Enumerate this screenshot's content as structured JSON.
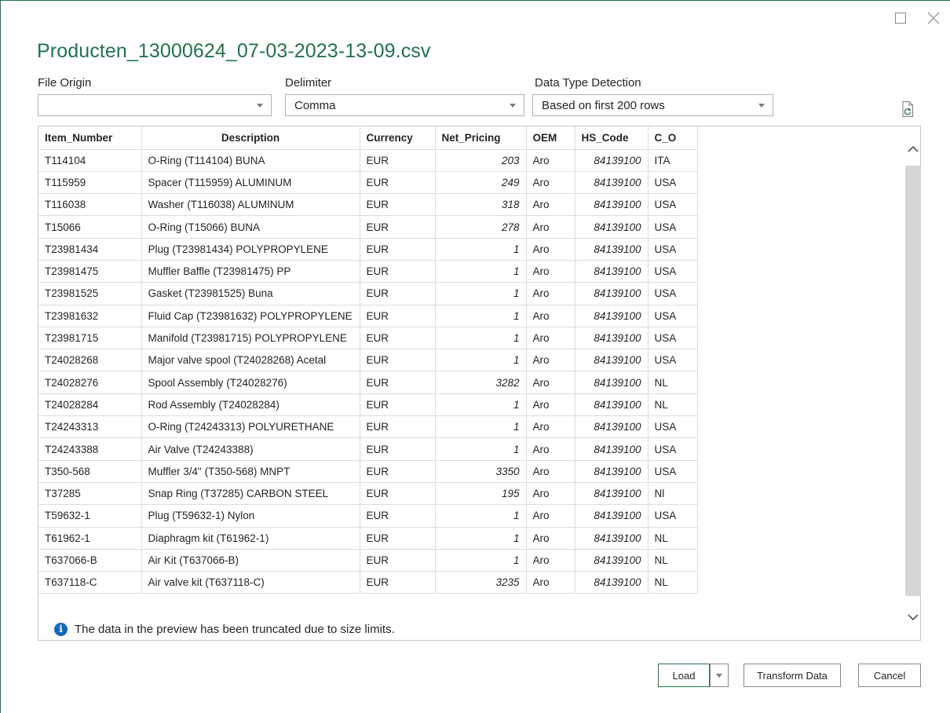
{
  "title": "Producten_13000624_07-03-2023-13-09.csv",
  "file_origin": {
    "label": "File Origin",
    "value": ""
  },
  "delimiter": {
    "label": "Delimiter",
    "value": "Comma"
  },
  "data_type_detection": {
    "label": "Data Type Detection",
    "value": "Based on first 200 rows"
  },
  "table": {
    "headers": [
      "Item_Number",
      "Description",
      "Currency",
      "Net_Pricing",
      "OEM",
      "HS_Code",
      "C_O"
    ],
    "rows": [
      [
        "T114104",
        "O-Ring (T114104) BUNA",
        "EUR",
        "203",
        "Aro",
        "84139100",
        "ITA"
      ],
      [
        "T115959",
        "Spacer (T115959) ALUMINUM",
        "EUR",
        "249",
        "Aro",
        "84139100",
        "USA"
      ],
      [
        "T116038",
        "Washer (T116038) ALUMINUM",
        "EUR",
        "318",
        "Aro",
        "84139100",
        "USA"
      ],
      [
        "T15066",
        "O-Ring (T15066) BUNA",
        "EUR",
        "278",
        "Aro",
        "84139100",
        "USA"
      ],
      [
        "T23981434",
        "Plug (T23981434) POLYPROPYLENE",
        "EUR",
        "1",
        "Aro",
        "84139100",
        "USA"
      ],
      [
        "T23981475",
        "Muffler Baffle (T23981475) PP",
        "EUR",
        "1",
        "Aro",
        "84139100",
        "USA"
      ],
      [
        "T23981525",
        "Gasket (T23981525) Buna",
        "EUR",
        "1",
        "Aro",
        "84139100",
        "USA"
      ],
      [
        "T23981632",
        "Fluid Cap (T23981632) POLYPROPYLENE",
        "EUR",
        "1",
        "Aro",
        "84139100",
        "USA"
      ],
      [
        "T23981715",
        "Manifold (T23981715) POLYPROPYLENE",
        "EUR",
        "1",
        "Aro",
        "84139100",
        "USA"
      ],
      [
        "T24028268",
        "Major valve spool (T24028268) Acetal",
        "EUR",
        "1",
        "Aro",
        "84139100",
        "USA"
      ],
      [
        "T24028276",
        "Spool Assembly (T24028276)",
        "EUR",
        "3282",
        "Aro",
        "84139100",
        "NL"
      ],
      [
        "T24028284",
        "Rod Assembly (T24028284)",
        "EUR",
        "1",
        "Aro",
        "84139100",
        "NL"
      ],
      [
        "T24243313",
        "O-Ring (T24243313) POLYURETHANE",
        "EUR",
        "1",
        "Aro",
        "84139100",
        "USA"
      ],
      [
        "T24243388",
        "Air Valve (T24243388)",
        "EUR",
        "1",
        "Aro",
        "84139100",
        "USA"
      ],
      [
        "T350-568",
        "Muffler 3/4\" (T350-568) MNPT",
        "EUR",
        "3350",
        "Aro",
        "84139100",
        "USA"
      ],
      [
        "T37285",
        "Snap Ring (T37285) CARBON STEEL",
        "EUR",
        "195",
        "Aro",
        "84139100",
        "Nl"
      ],
      [
        "T59632-1",
        "Plug (T59632-1) Nylon",
        "EUR",
        "1",
        "Aro",
        "84139100",
        "USA"
      ],
      [
        "T61962-1",
        "Diaphragm kit (T61962-1)",
        "EUR",
        "1",
        "Aro",
        "84139100",
        "NL"
      ],
      [
        "T637066-B",
        "Air Kit (T637066-B)",
        "EUR",
        "1",
        "Aro",
        "84139100",
        "NL"
      ],
      [
        "T637118-C",
        "Air valve kit (T637118-C)",
        "EUR",
        "3235",
        "Aro",
        "84139100",
        "NL"
      ]
    ]
  },
  "info_message": "The data in the preview has been truncated due to size limits.",
  "info_icon_glyph": "i",
  "buttons": {
    "load": "Load",
    "transform": "Transform Data",
    "cancel": "Cancel"
  },
  "colors": {
    "accent": "#217346",
    "info": "#0f6cbd"
  },
  "icons": [
    "maximize-icon",
    "close-icon",
    "refresh-icon",
    "info-icon",
    "chevron-up-icon",
    "chevron-down-icon"
  ]
}
